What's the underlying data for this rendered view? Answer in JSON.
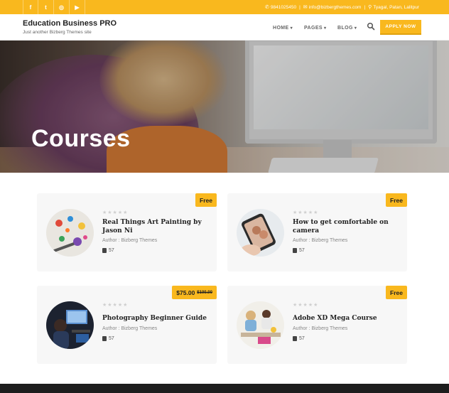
{
  "topbar": {
    "social": [
      {
        "name": "facebook-icon",
        "glyph": "f"
      },
      {
        "name": "twitter-icon",
        "glyph": "t"
      },
      {
        "name": "instagram-icon",
        "glyph": "◎"
      },
      {
        "name": "youtube-icon",
        "glyph": "▶"
      }
    ],
    "phone": "9841025450",
    "email": "info@bizbergthemes.com",
    "address": "Tyagal, Patan, Lalitpur"
  },
  "header": {
    "site_title": "Education Business PRO",
    "tagline": "Just another Bizberg Themes site",
    "nav": [
      "HOME",
      "PAGES",
      "BLOG"
    ],
    "apply_label": "APPLY NOW"
  },
  "hero": {
    "title": "Courses"
  },
  "courses": [
    {
      "title": "Real Things Art Painting by Jason Ni",
      "author": "Author : Bizberg Themes",
      "lessons": "57",
      "price": "Free",
      "old_price": ""
    },
    {
      "title": "How to get comfortable on camera",
      "author": "Author : Bizberg Themes",
      "lessons": "57",
      "price": "Free",
      "old_price": ""
    },
    {
      "title": "Photography Beginner Guide",
      "author": "Author : Bizberg Themes",
      "lessons": "57",
      "price": "$75.00",
      "old_price": "$100.00"
    },
    {
      "title": "Adobe XD Mega Course",
      "author": "Author : Bizberg Themes",
      "lessons": "57",
      "price": "Free",
      "old_price": ""
    }
  ],
  "stars_glyph": "★★★★★",
  "colors": {
    "accent": "#f9b81e",
    "footer": "#1d1d1d",
    "card_bg": "#f7f7f7"
  }
}
